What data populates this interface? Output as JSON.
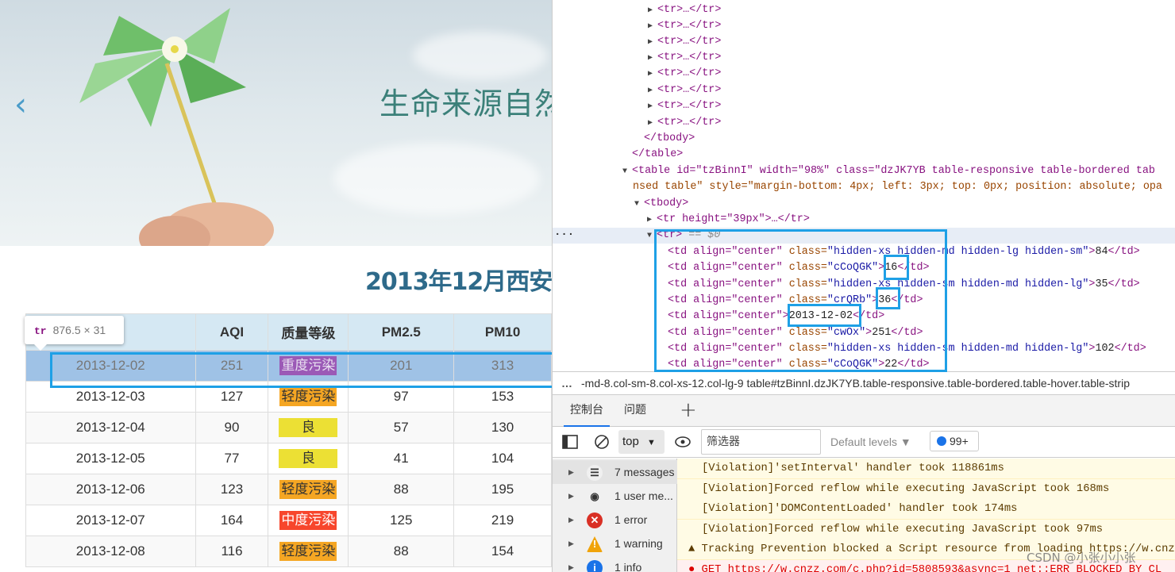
{
  "page": {
    "banner_title": "生命来源自然",
    "heading": "2013年12月西安",
    "table": {
      "headers": [
        "",
        "AQI",
        "质量等级",
        "PM2.5",
        "PM10"
      ],
      "rows": [
        {
          "date": "2013-12-02",
          "aqi": "251",
          "level": "重度污染",
          "pm25": "201",
          "pm10": "313",
          "level_color": "#9b59b6"
        },
        {
          "date": "2013-12-03",
          "aqi": "127",
          "level": "轻度污染",
          "pm25": "97",
          "pm10": "153",
          "level_color": "#f5a623"
        },
        {
          "date": "2013-12-04",
          "aqi": "90",
          "level": "良",
          "pm25": "57",
          "pm10": "130",
          "level_color": "#ece034"
        },
        {
          "date": "2013-12-05",
          "aqi": "77",
          "level": "良",
          "pm25": "41",
          "pm10": "104",
          "level_color": "#ece034"
        },
        {
          "date": "2013-12-06",
          "aqi": "123",
          "level": "轻度污染",
          "pm25": "88",
          "pm10": "195",
          "level_color": "#f5a623"
        },
        {
          "date": "2013-12-07",
          "aqi": "164",
          "level": "中度污染",
          "pm25": "125",
          "pm10": "219",
          "level_color": "#f7462c"
        },
        {
          "date": "2013-12-08",
          "aqi": "116",
          "level": "轻度污染",
          "pm25": "88",
          "pm10": "154",
          "level_color": "#f5a623"
        }
      ]
    },
    "tooltip": {
      "tag": "tr",
      "size": "876.5 × 31"
    }
  },
  "devtools": {
    "dom_lines": [
      "<tr>…</tr>",
      "</tbody>",
      "</table>",
      "<table id=\"tzBinnI\" width=\"98%\" class=\"dzJK7YB  table-responsive table-bordered tab",
      "nsed table\" style=\"margin-bottom: 4px; left: 3px; top: 0px; position: absolute; opa",
      "<tbody>",
      "<tr height=\"39px\">…</tr>",
      "<tr>",
      "== $0"
    ],
    "td_rows": [
      {
        "cls": "hidden-xs hidden-md hidden-lg hidden-sm",
        "val": "84"
      },
      {
        "cls": "cCoQGK",
        "val": "16"
      },
      {
        "cls": "hidden-xs hidden-sm hidden-md hidden-lg",
        "val": "35"
      },
      {
        "cls": "crQRb",
        "val": "36"
      },
      {
        "cls": "",
        "val": "2013-12-02"
      },
      {
        "cls": "cwOx",
        "val": "251"
      },
      {
        "cls": "hidden-xs hidden-sm hidden-md hidden-lg",
        "val": "102"
      },
      {
        "cls": "cCoQGK",
        "val": "22"
      }
    ],
    "td_prefix": "<td align=\"center\"",
    "breadcrumb": "-md-8.col-sm-8.col-xs-12.col-lg-9    table#tzBinnI.dzJK7YB.table-responsive.table-bordered.table-hover.table-strip",
    "tabs": [
      "控制台",
      "问题",
      "+"
    ],
    "context": "top",
    "filter_placeholder": "筛选器",
    "levels_label": "Default levels ▼",
    "issues_count": "99+",
    "sidebar": [
      {
        "label": "7 messages",
        "icon": "list-icon"
      },
      {
        "label": "1 user me...",
        "icon": "user-icon"
      },
      {
        "label": "1 error",
        "icon": "error-icon"
      },
      {
        "label": "1 warning",
        "icon": "warning-icon"
      },
      {
        "label": "1 info",
        "icon": "info-icon"
      }
    ],
    "messages": [
      "[Violation]'setInterval' handler took 118861ms",
      "[Violation]Forced reflow while executing JavaScript took 168ms",
      "[Violation]'DOMContentLoaded' handler took 174ms",
      "[Violation]Forced reflow while executing JavaScript took 97ms",
      "▲ Tracking Prevention blocked a Script resource from loading https://w.cnzz",
      "● GET https://w.cnzz.com/c.php?id=5808593&async=1 net::ERR_BLOCKED_BY_CL"
    ]
  },
  "watermark": "CSDN @小张小小张"
}
